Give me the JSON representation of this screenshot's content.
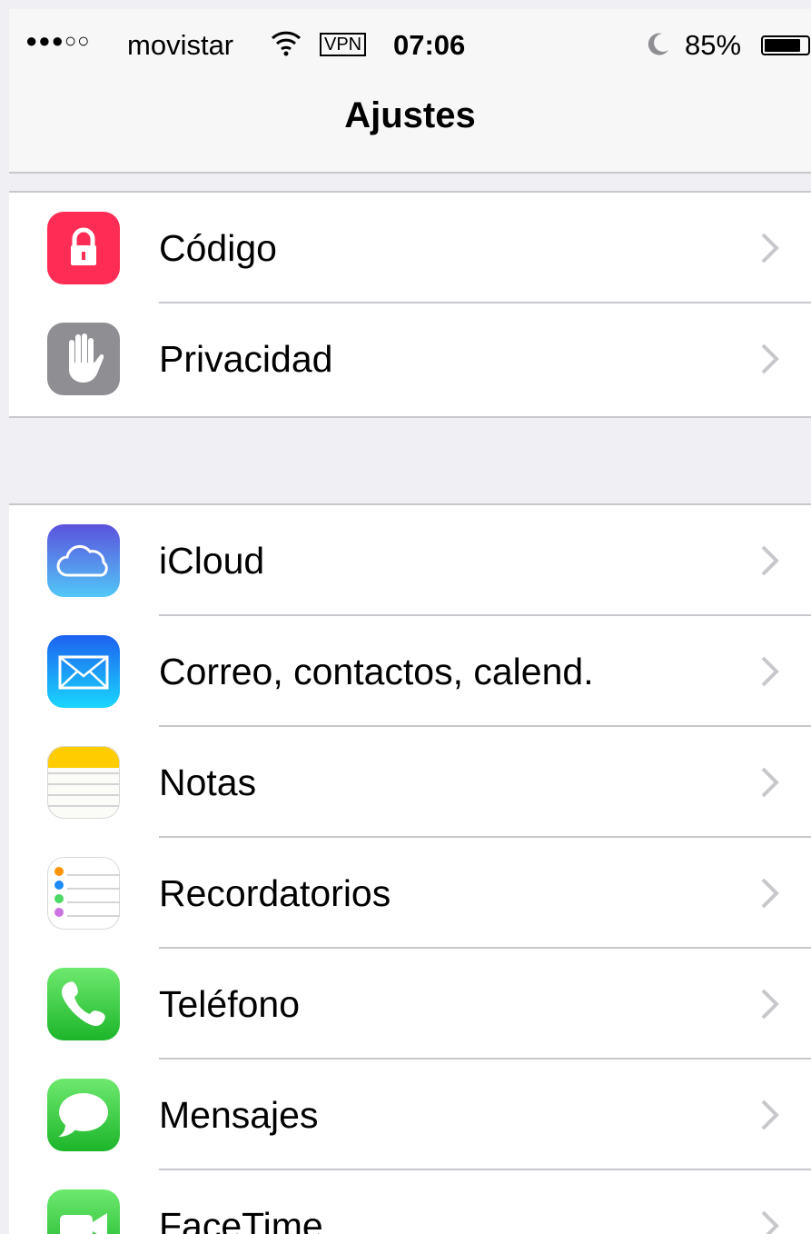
{
  "status_bar": {
    "signal": "●●●○○",
    "carrier": "movistar",
    "vpn": "VPN",
    "time": "07:06",
    "battery_percent": "85%",
    "battery_level": 0.85,
    "icons": [
      "wifi-icon",
      "moon-icon",
      "battery-icon"
    ]
  },
  "nav": {
    "title": "Ajustes"
  },
  "groups": [
    {
      "items": [
        {
          "label": "Código",
          "icon": "lock-icon",
          "color": "#ff2d55"
        },
        {
          "label": "Privacidad",
          "icon": "hand-icon",
          "color": "#8e8e93"
        }
      ]
    },
    {
      "items": [
        {
          "label": "iCloud",
          "icon": "cloud-icon",
          "color": "#4a77e6"
        },
        {
          "label": "Correo, contactos, calend.",
          "icon": "mail-icon",
          "color": "#1e8cf7"
        },
        {
          "label": "Notas",
          "icon": "notes-icon",
          "color": "#ffcc00"
        },
        {
          "label": "Recordatorios",
          "icon": "reminders-icon",
          "color": "#ffffff"
        },
        {
          "label": "Teléfono",
          "icon": "phone-icon",
          "color": "#3dd34c"
        },
        {
          "label": "Mensajes",
          "icon": "messages-icon",
          "color": "#3dd34c"
        },
        {
          "label": "FaceTime",
          "icon": "facetime-icon",
          "color": "#3dd34c"
        }
      ]
    }
  ]
}
